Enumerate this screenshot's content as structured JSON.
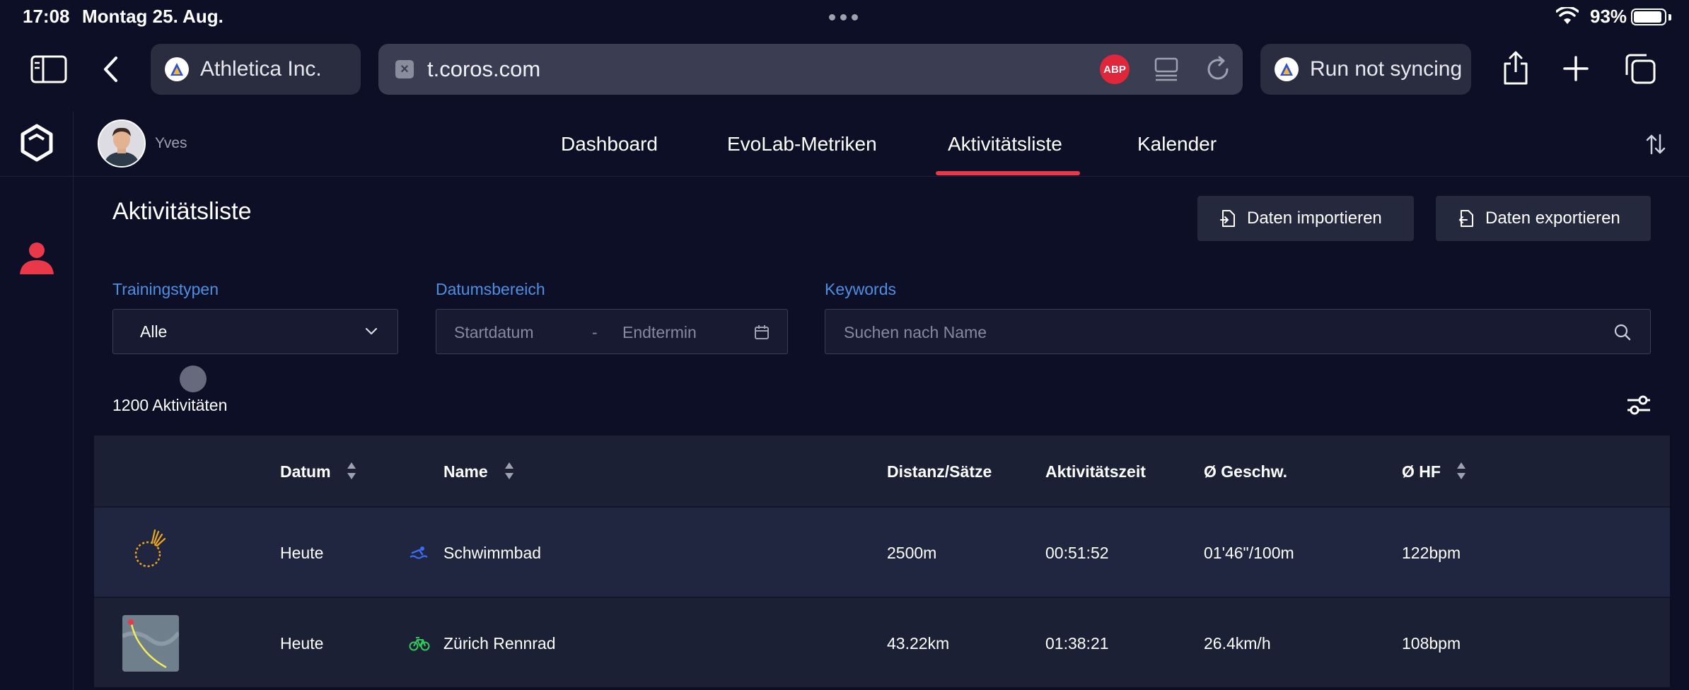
{
  "status_bar": {
    "time": "17:08",
    "date": "Montag 25. Aug.",
    "battery": "93%",
    "battery_level": 0.93
  },
  "browser": {
    "tab_left": "Athletica Inc.",
    "url": "t.coros.com",
    "adblock_label": "ABP",
    "tab_right": "Run not syncing"
  },
  "app": {
    "user_name": "Yves",
    "nav": [
      "Dashboard",
      "EvoLab-Metriken",
      "Aktivitätsliste",
      "Kalender"
    ],
    "active_nav": "Aktivitätsliste"
  },
  "page": {
    "title": "Aktivitätsliste",
    "import_label": "Daten importieren",
    "export_label": "Daten exportieren",
    "filters": {
      "type_label": "Trainingstypen",
      "type_value": "Alle",
      "date_label": "Datumsbereich",
      "start_placeholder": "Startdatum",
      "date_separator": "-",
      "end_placeholder": "Endtermin",
      "keyword_label": "Keywords",
      "keyword_placeholder": "Suchen nach Name"
    },
    "count": "1200 Aktivitäten"
  },
  "table": {
    "headers": {
      "date": "Datum",
      "name": "Name",
      "distance": "Distanz/Sätze",
      "time": "Aktivitätszeit",
      "speed": "Ø Geschw.",
      "hr": "Ø HF"
    },
    "rows": [
      {
        "date": "Heute",
        "sport_icon": "swim-icon",
        "name": "Schwimmbad",
        "distance": "2500m",
        "time": "00:51:52",
        "speed": "01'46\"/100m",
        "hr": "122bpm"
      },
      {
        "date": "Heute",
        "sport_icon": "bike-icon",
        "name": "Zürich Rennrad",
        "distance": "43.22km",
        "time": "01:38:21",
        "speed": "26.4km/h",
        "hr": "108bpm"
      }
    ]
  },
  "colors": {
    "background": "#0c0f26",
    "accent_red": "#e8384a",
    "label_blue": "#4f8fe3",
    "swim_blue": "#3b6cf2",
    "bike_green": "#34c759"
  }
}
